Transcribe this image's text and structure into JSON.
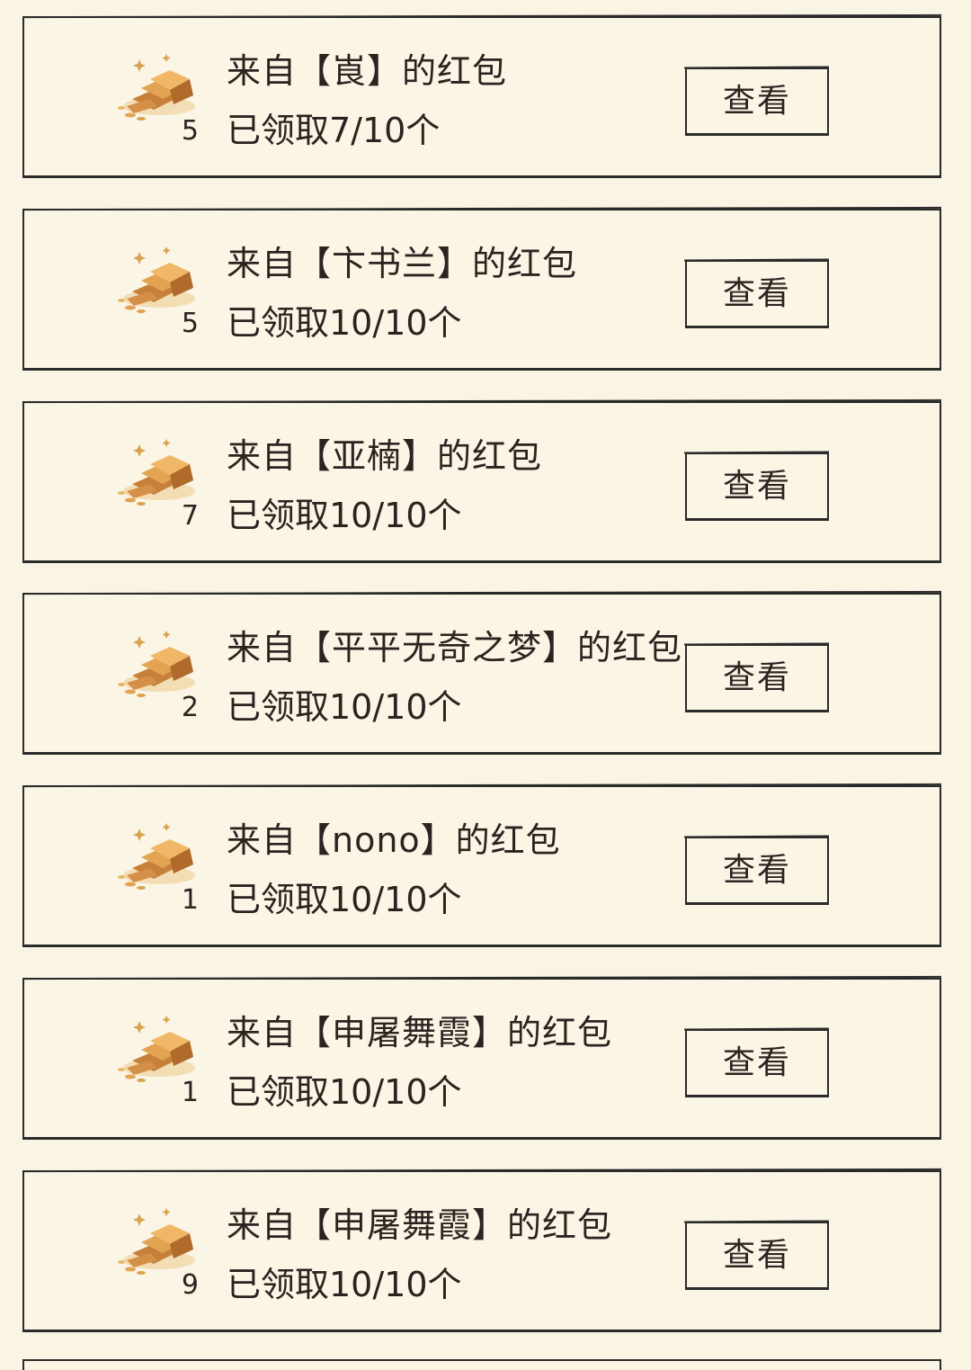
{
  "view_label": "查看",
  "items": [
    {
      "title": "来自【崀】的红包",
      "status": "已领取7/10个",
      "count": "5"
    },
    {
      "title": "来自【卞书兰】的红包",
      "status": "已领取10/10个",
      "count": "5"
    },
    {
      "title": "来自【亚楠】的红包",
      "status": "已领取10/10个",
      "count": "7"
    },
    {
      "title": "来自【平平无奇之梦】的红包",
      "status": "已领取10/10个",
      "count": "2"
    },
    {
      "title": "来自【nono】的红包",
      "status": "已领取10/10个",
      "count": "1"
    },
    {
      "title": "来自【申屠舞霞】的红包",
      "status": "已领取10/10个",
      "count": "1"
    },
    {
      "title": "来自【申屠舞霞】的红包",
      "status": "已领取10/10个",
      "count": "9"
    }
  ],
  "colors": {
    "background": "#faf4e4",
    "border": "#2b2b2b",
    "gold": "#e2a352"
  },
  "icon": "gold-bars-icon"
}
